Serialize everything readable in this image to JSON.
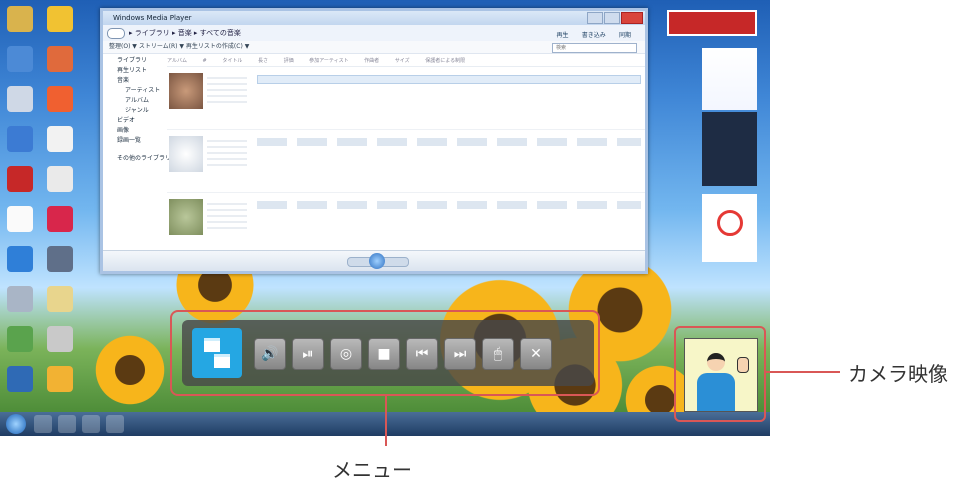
{
  "callouts": {
    "camera_label": "カメラ映像",
    "menu_label": "メニュー",
    "accent_color": "#d95756"
  },
  "wmp": {
    "title": "Windows Media Player",
    "breadcrumb": "▸ ライブラリ ▸ 音楽 ▸ すべての音楽",
    "tabs": [
      "再生",
      "書き込み",
      "同期"
    ],
    "toolbar": "整理(O) ▼    ストリーム(R) ▼    再生リストの作成(C) ▼",
    "search_placeholder": "検索",
    "sidebar": [
      "ライブラリ",
      "再生リスト",
      "音楽",
      "アーティスト",
      "アルバム",
      "ジャンル",
      "ビデオ",
      "画像",
      "録画一覧",
      "その他のライブラリ"
    ],
    "columns": [
      "アルバム",
      "#",
      "タイトル",
      "長さ",
      "評価",
      "参加アーティスト",
      "作曲者",
      "サイズ",
      "保護者による制限"
    ]
  },
  "desktop_icons": [
    {
      "icon": "computer-icon",
      "color": "#d9b34d"
    },
    {
      "icon": "internet-icon",
      "color": "#f1c232"
    },
    {
      "icon": "network-icon",
      "color": "#4c8ad6"
    },
    {
      "icon": "user-icon",
      "color": "#e06a3c"
    },
    {
      "icon": "recycle-bin-icon",
      "color": "#cfd8e6"
    },
    {
      "icon": "mail-icon",
      "color": "#f06030"
    },
    {
      "icon": "help-icon",
      "color": "#3c7bd3"
    },
    {
      "icon": "tv-icon",
      "color": "#f2f2f2"
    },
    {
      "icon": "3d-icon",
      "color": "#c62828"
    },
    {
      "icon": "manual-icon",
      "color": "#eaeaea"
    },
    {
      "icon": "amazon-icon",
      "color": "#fafafa"
    },
    {
      "icon": "opera-icon",
      "color": "#d8264b"
    },
    {
      "icon": "ie-icon",
      "color": "#2f7fd8"
    },
    {
      "icon": "tool-icon",
      "color": "#5f6f89"
    },
    {
      "icon": "spider-icon",
      "color": "#a9b5c6"
    },
    {
      "icon": "folder-icon",
      "color": "#e8d58d"
    },
    {
      "icon": "photo-icon",
      "color": "#5aa34d"
    },
    {
      "icon": "disc-icon",
      "color": "#c9c9c9"
    },
    {
      "icon": "info-icon",
      "color": "#2f6ab5"
    },
    {
      "icon": "support-icon",
      "color": "#f2b233"
    }
  ],
  "menu": {
    "buttons": [
      {
        "name": "switch-window-button",
        "icon": "window-switch-icon",
        "glyph": ""
      },
      {
        "name": "volume-button",
        "icon": "speaker-icon",
        "glyph": "🔊"
      },
      {
        "name": "play-pause-button",
        "icon": "play-pause-icon",
        "glyph": "⏯"
      },
      {
        "name": "dvd-button",
        "icon": "disc-icon",
        "glyph": "◎"
      },
      {
        "name": "stop-button",
        "icon": "stop-icon",
        "glyph": "■"
      },
      {
        "name": "previous-button",
        "icon": "previous-icon",
        "glyph": "⏮"
      },
      {
        "name": "next-button",
        "icon": "next-icon",
        "glyph": "⏭"
      },
      {
        "name": "mouse-button",
        "icon": "mouse-icon",
        "glyph": "🖱"
      },
      {
        "name": "close-menu-button",
        "icon": "close-icon",
        "glyph": "✕"
      }
    ]
  }
}
